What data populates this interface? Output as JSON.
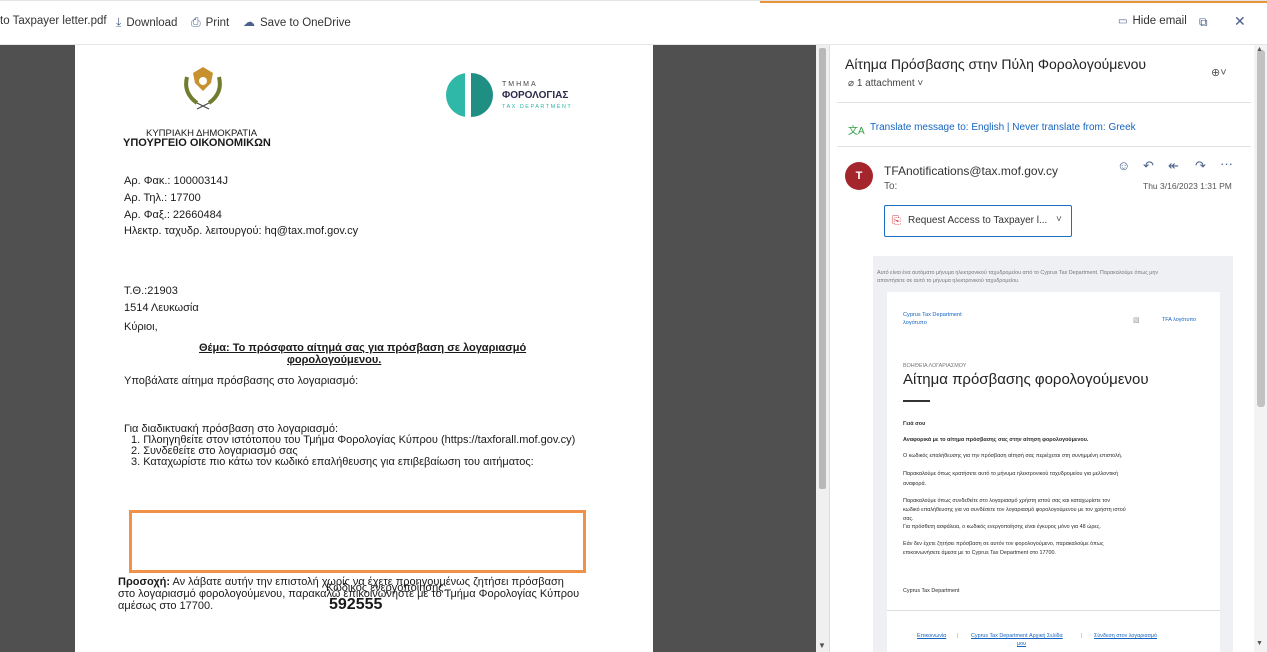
{
  "toolbar": {
    "file_name": "to Taxpayer letter.pdf",
    "download": "Download",
    "print": "Print",
    "save_onedrive": "Save to OneDrive",
    "hide_email": "Hide email",
    "icons": [
      "download-icon",
      "print-icon",
      "onedrive-icon",
      "hide-email-icon",
      "popout-icon",
      "close-icon"
    ]
  },
  "letter": {
    "republic": "ΚΥΠΡΙΑΚΗ ΔΗΜΟΚΡΑΤΙΑ",
    "ministry": "ΥΠΟΥΡΓΕΙΟ ΟΙΚΟΝΟΜΙΚΩΝ",
    "dept_gr_small": "ΤΜΗΜΑ",
    "dept_gr_big": "ΦΟΡΟΛΟΓΙΑΣ",
    "dept_en": "TAX DEPARTMENT",
    "file_no": "Αρ. Φακ.: 10000314J",
    "tel": "Αρ. Τηλ.: 17700",
    "fax": "Αρ. Φαξ.: 22660484",
    "email": "Ηλεκτρ. ταχυδρ. λειτουργού: hq@tax.mof.gov.cy",
    "po_box": "T.Θ.:21903",
    "city": "1514  Λευκωσία",
    "salutation": "Κύριοι,",
    "subject_line1": "Θέμα: Το πρόσφατο αίτημά σας για πρόσβαση σε λογαριασμό",
    "subject_line2": "φορολογούμενου.",
    "submitted": "Υποβάλατε αίτημα πρόσβασης στο λογαριασμό:",
    "online_access": "Για διαδικτυακή πρόσβαση στο λογαριασμό:",
    "steps": [
      "1.   Πλοηγηθείτε στον ιστότοπου του Τμήμα Φορολογίας Κύπρου (https://taxforall.mof.gov.cy)",
      "2.   Συνδεθείτε στο λογαριασμό σας",
      "3.   Καταχωρίστε πιο κάτω τον κωδικό επαλήθευσης για επιβεβαίωση του αιτήματος:"
    ],
    "code_label": "Κωδικός ενεργοποίησης:",
    "code_value": "592555",
    "warning_label": "Προσοχή:",
    "warning_line1": " Αν λάβατε αυτήν την επιστολή χωρίς να έχετε προηγουμένως ζητήσει πρόσβαση",
    "warning_line2": "στο λογαριασμό φορολογούμενου, παρακαλώ επικοινωνήστε με το Τμήμα Φορολογίας Κύπρου",
    "warning_line3": "αμέσως στο 17700."
  },
  "email_pane": {
    "subject": "Αίτημα Πρόσβασης στην Πύλη Φορολογούμενου",
    "attachment_count": "1 attachment",
    "translate": "Translate message to: English | Never translate from: Greek",
    "avatar_initial": "T",
    "sender": "TFAnotifications@tax.mof.gov.cy",
    "to_label": "To:",
    "date": "Thu 3/16/2023 1:31 PM",
    "attachment_name": "Request Access to Taxpayer l...",
    "body": {
      "notice": "Αυτό είναι ένα αυτόματο μήνυμα ηλεκτρονικού ταχυδρομείου από το Cyprus Tax Department. Παρακαλούμε όπως μην",
      "notice2": "απαντήσετε σε αυτό το μήνυμα ηλεκτρονικού ταχυδρομείου.",
      "logo_alt_1": "Cyprus Tax Department",
      "logo_alt_2": "λογότυπο",
      "logo_right": "TFA λογότυπο",
      "kicker": "ΒΟΗΘΕΙΑ ΛΟΓΑΡΙΑΣΜΟΥ",
      "heading": "Αίτημα πρόσβασης φορολογούμενου",
      "greeting": "Γειά σου",
      "ref": "Αναφορικά με το αίτημα πρόσβασης σας στην αίτηση φορολογούμενου.",
      "p1": "Ο κωδικός επαλήθευσης για την πρόσβαση αίτησή σας περιέχεται στη συνημμένη επιστολή.",
      "p2a": "Παρακαλούμε όπως κρατήσετε αυτό το μήνυμα ηλεκτρονικού ταχυδρομείου για μελλοντική",
      "p2b": "αναφορά.",
      "p3a": "Παρακαλούμε όπως συνδεθείτε στο λογαριασμό χρήστη ιστού σας και καταχωρίστε τον",
      "p3b": "κωδικό επαλήθευσης για να συνδέσετε τον λογαριασμό φορολογούμενου με τον χρήστη ιστού",
      "p3c": "σας.",
      "p4": "Για πρόσθετη ασφάλεια, ο κωδικός ενεργοποίησης είναι έγκυρος μόνο για 48 ώρες.",
      "p5a": "Εάν δεν έχετε ζητήσει πρόσβαση σε αυτόν τον φορολογούμενο, παρακαλούμε όπως",
      "p5b": "επικοινωνήσετε άμεσα με το Cyprus Tax Department στο 17700.",
      "signoff": "Cyprus Tax Department",
      "footer_links": [
        "Επικοινωνία",
        "Cyprus Tax Department Αρχική Σελίδα",
        "Σύνδεση στον λογαριασμό"
      ],
      "footer_wrap": "μου",
      "separator": "|"
    }
  },
  "colors": {
    "highlight_box": "#f0914a",
    "avatar_bg": "#a4262c",
    "link": "#1565c0",
    "brand_teal": "#2fb7a8"
  }
}
